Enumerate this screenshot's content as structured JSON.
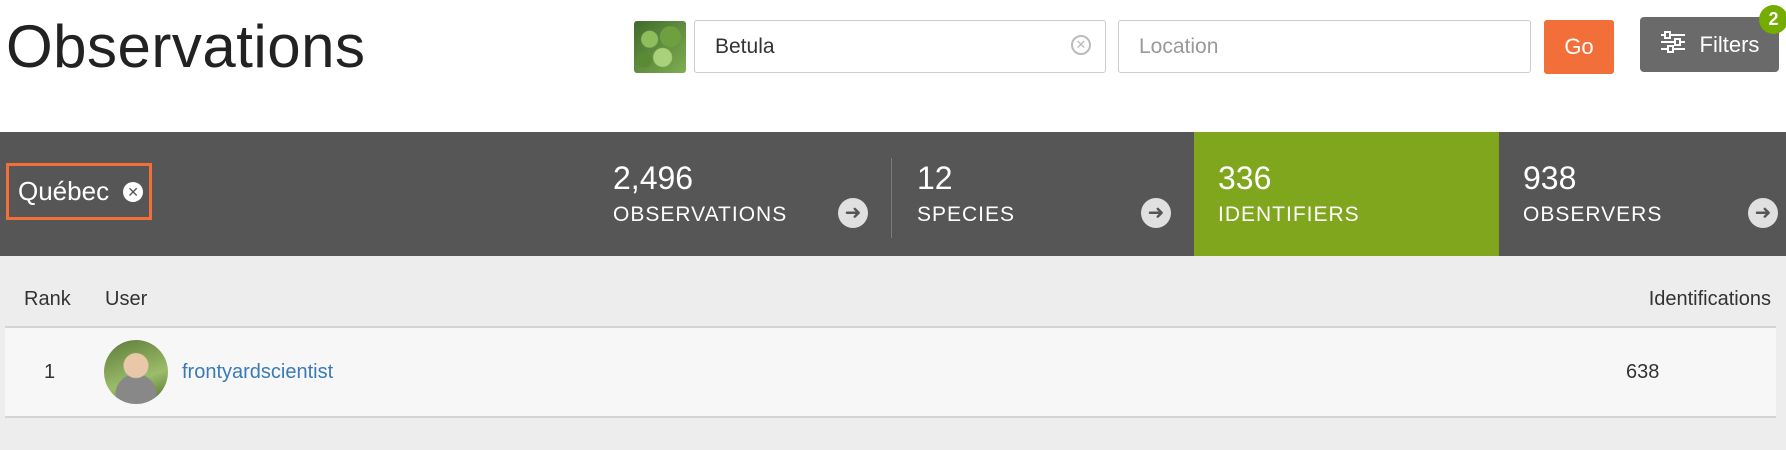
{
  "header": {
    "title": "Observations",
    "taxon_value": "Betula",
    "location_placeholder": "Location",
    "go_label": "Go",
    "filters_label": "Filters",
    "filters_count": "2"
  },
  "place_chip": {
    "label": "Québec"
  },
  "stats": {
    "observations": {
      "count": "2,496",
      "label": "Observations"
    },
    "species": {
      "count": "12",
      "label": "Species"
    },
    "identifiers": {
      "count": "336",
      "label": "Identifiers"
    },
    "observers": {
      "count": "938",
      "label": "Observers"
    },
    "active_color": "#7fa61d"
  },
  "table": {
    "headers": {
      "rank": "Rank",
      "user": "User",
      "identifications": "Identifications"
    },
    "rows": [
      {
        "rank": "1",
        "user": "frontyardscientist",
        "identifications": "638"
      }
    ]
  },
  "icons": [
    "taxon-thumbnail",
    "clear-icon",
    "sliders-icon",
    "close-icon",
    "arrow-right-icon",
    "user-avatar"
  ],
  "colors": {
    "accent_orange": "#f26f3a",
    "green": "#7fa61d",
    "dark_bar": "#565656",
    "link": "#3b7ab5"
  }
}
